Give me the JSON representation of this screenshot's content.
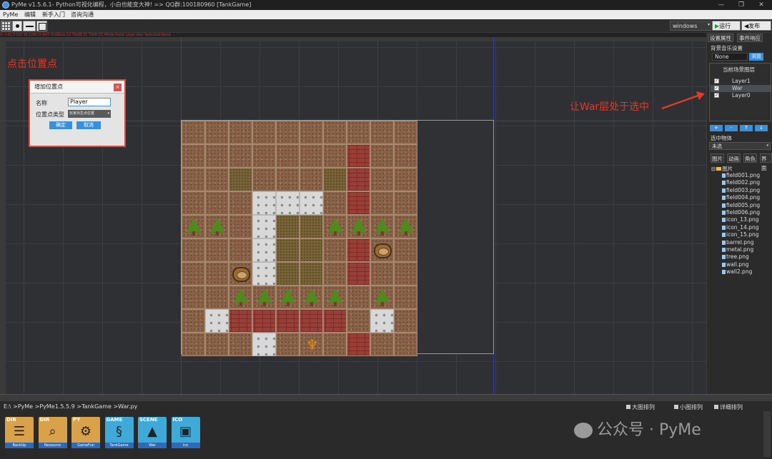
{
  "window": {
    "title": "PyMe v1.5.6.1- Python可视化编程，小白也能变大神!  => QQ群:100180960   [TankGame]",
    "controls": [
      "—",
      "❐",
      "✕"
    ]
  },
  "menu": [
    "PyMe",
    "编辑",
    "新手入门",
    "咨询沟通"
  ],
  "toolbar": {
    "platform": "windows",
    "run_label": "运行",
    "publish_label": "发布"
  },
  "status_text": "X:-142,Y:100 W:1080,H:643 GridSize:10 TileW:32 TileH:32 Mode:Point Layer:War Selected:None",
  "annotations": {
    "click_point": "点击位置点",
    "select_war": "让War层处于选中"
  },
  "dialog": {
    "title": "增加位置点",
    "close": "×",
    "name_label": "名称",
    "name_value": "Player",
    "type_label": "位置点类型",
    "type_value": "玩家出生点位置",
    "ok_label": "确定",
    "cancel_label": "取消"
  },
  "map": {
    "cols": 10,
    "rows": 10,
    "legend": {
      "d": "dirt",
      "g": "grass",
      "w": "wall",
      "m": "metal",
      "t": "tree",
      "b": "barrel",
      "e": "eagle"
    },
    "grid": [
      "dddddddddd",
      "dddddddwdd",
      "ddgdddgwdd",
      "dddmmmdwdd",
      "ttdmggttttd",
      "dddmggdwbd",
      "ddbmggdwdd",
      "ddtttttdtdd",
      "dmwwwwwdmd",
      "dddmdedwdd"
    ]
  },
  "right_panel": {
    "tabs": [
      "设置属性",
      "事件响应"
    ],
    "music_label": "背景音乐设置",
    "music_value": "None",
    "browse_label": "浏览",
    "layers_title": "当前场景图层",
    "layers": [
      {
        "name": "Layer1",
        "checked": true,
        "selected": false
      },
      {
        "name": "War",
        "checked": true,
        "selected": true
      },
      {
        "name": "Layer0",
        "checked": true,
        "selected": false
      }
    ],
    "layer_buttons": [
      "+",
      "-",
      "↑",
      "↓"
    ],
    "selected_object_label": "选中物体",
    "selected_object_value": "未选",
    "resource_tabs": [
      "图片",
      "动画",
      "角色",
      "界面"
    ],
    "tree_root": "图片",
    "files": [
      "field001.png",
      "field002.png",
      "field003.png",
      "field004.png",
      "field005.png",
      "field006.png",
      "icon_13.png",
      "icon_14.png",
      "icon_15.png",
      "barrel.png",
      "metal.png",
      "tree.png",
      "wall.png",
      "wall2.png"
    ]
  },
  "bottom": {
    "path": "E:\\ >PyMe >PyMe1.5.5.9 >TankGame >War.py",
    "view_options": [
      "大图排列",
      "小图排列",
      "详细排列"
    ],
    "dirs": [
      {
        "tag": "DIR",
        "caption": "BackUp",
        "icon": "layers-icon",
        "color": "#d8a14a"
      },
      {
        "tag": "DIR",
        "caption": "Resource",
        "icon": "search-doc-icon",
        "color": "#d8a14a"
      },
      {
        "tag": "PY",
        "caption": "GameFun",
        "icon": "python-icon",
        "color": "#d8a14a"
      },
      {
        "tag": "GAME",
        "caption": "TankGame",
        "icon": "snake-icon",
        "color": "#3fa9d8"
      },
      {
        "tag": "SCENE",
        "caption": "War",
        "icon": "mountain-icon",
        "color": "#3fa9d8"
      },
      {
        "tag": "ICO",
        "caption": "ico",
        "icon": "ico-icon",
        "color": "#3fa9d8"
      }
    ],
    "watermark": "公众号 · PyMe"
  }
}
